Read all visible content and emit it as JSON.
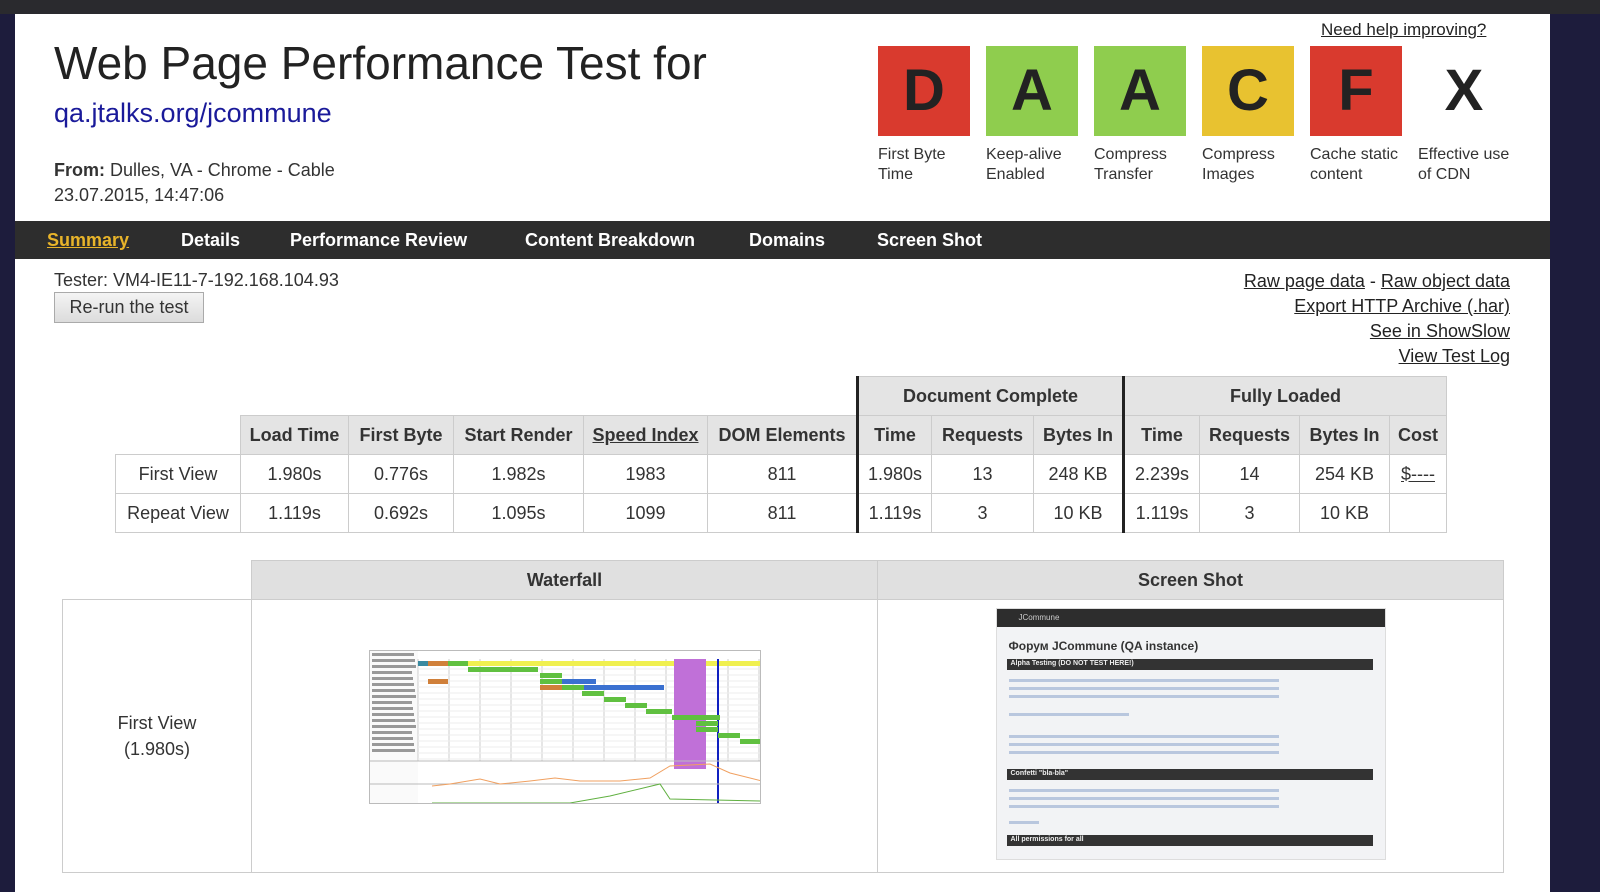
{
  "header": {
    "title": "Web Page Performance Test for",
    "url": "qa.jtalks.org/jcommune",
    "from_label": "From:",
    "from_value": "Dulles, VA - Chrome - Cable",
    "datetime": "23.07.2015, 14:47:06",
    "help_link": "Need help improving?"
  },
  "grades": [
    {
      "grade": "D",
      "label": "First Byte Time",
      "color": "#d93a2e"
    },
    {
      "grade": "A",
      "label": "Keep-alive Enabled",
      "color": "#8fcd4e"
    },
    {
      "grade": "A",
      "label": "Compress Transfer",
      "color": "#8fcd4e"
    },
    {
      "grade": "C",
      "label": "Compress Images",
      "color": "#e8c230"
    },
    {
      "grade": "F",
      "label": "Cache static content",
      "color": "#d93a2e"
    },
    {
      "grade": "X",
      "label": "Effective use of CDN",
      "color": "#ffffff"
    }
  ],
  "nav": [
    "Summary",
    "Details",
    "Performance Review",
    "Content Breakdown",
    "Domains",
    "Screen Shot"
  ],
  "tester": "Tester: VM4-IE11-7-192.168.104.93",
  "rerun": "Re-run the test",
  "links": {
    "raw_page": "Raw page data",
    "sep": " - ",
    "raw_object": "Raw object data",
    "har": "Export HTTP Archive (.har)",
    "showslow": "See in ShowSlow",
    "log": "View Test Log"
  },
  "results": {
    "groups": [
      "Document Complete",
      "Fully Loaded"
    ],
    "headers": [
      "Load Time",
      "First Byte",
      "Start Render",
      "Speed Index",
      "DOM Elements",
      "Time",
      "Requests",
      "Bytes In",
      "Time",
      "Requests",
      "Bytes In",
      "Cost"
    ],
    "rows": [
      [
        "First View",
        "1.980s",
        "0.776s",
        "1.982s",
        "1983",
        "811",
        "1.980s",
        "13",
        "248 KB",
        "2.239s",
        "14",
        "254 KB",
        "$----"
      ],
      [
        "Repeat View",
        "1.119s",
        "0.692s",
        "1.095s",
        "1099",
        "811",
        "1.119s",
        "3",
        "10 KB",
        "1.119s",
        "3",
        "10 KB",
        ""
      ]
    ]
  },
  "waterfall": {
    "col_waterfall": "Waterfall",
    "col_screenshot": "Screen Shot",
    "row_label": "First View",
    "row_time": "(1.980s)"
  },
  "screenshot": {
    "app": "JCommune",
    "title": "Форум JCommune (QA instance)",
    "sections": [
      "Alpha Testing (DO NOT TEST HERE!)",
      "Confetti \"bla-bla\"",
      "All permissions for all"
    ]
  }
}
